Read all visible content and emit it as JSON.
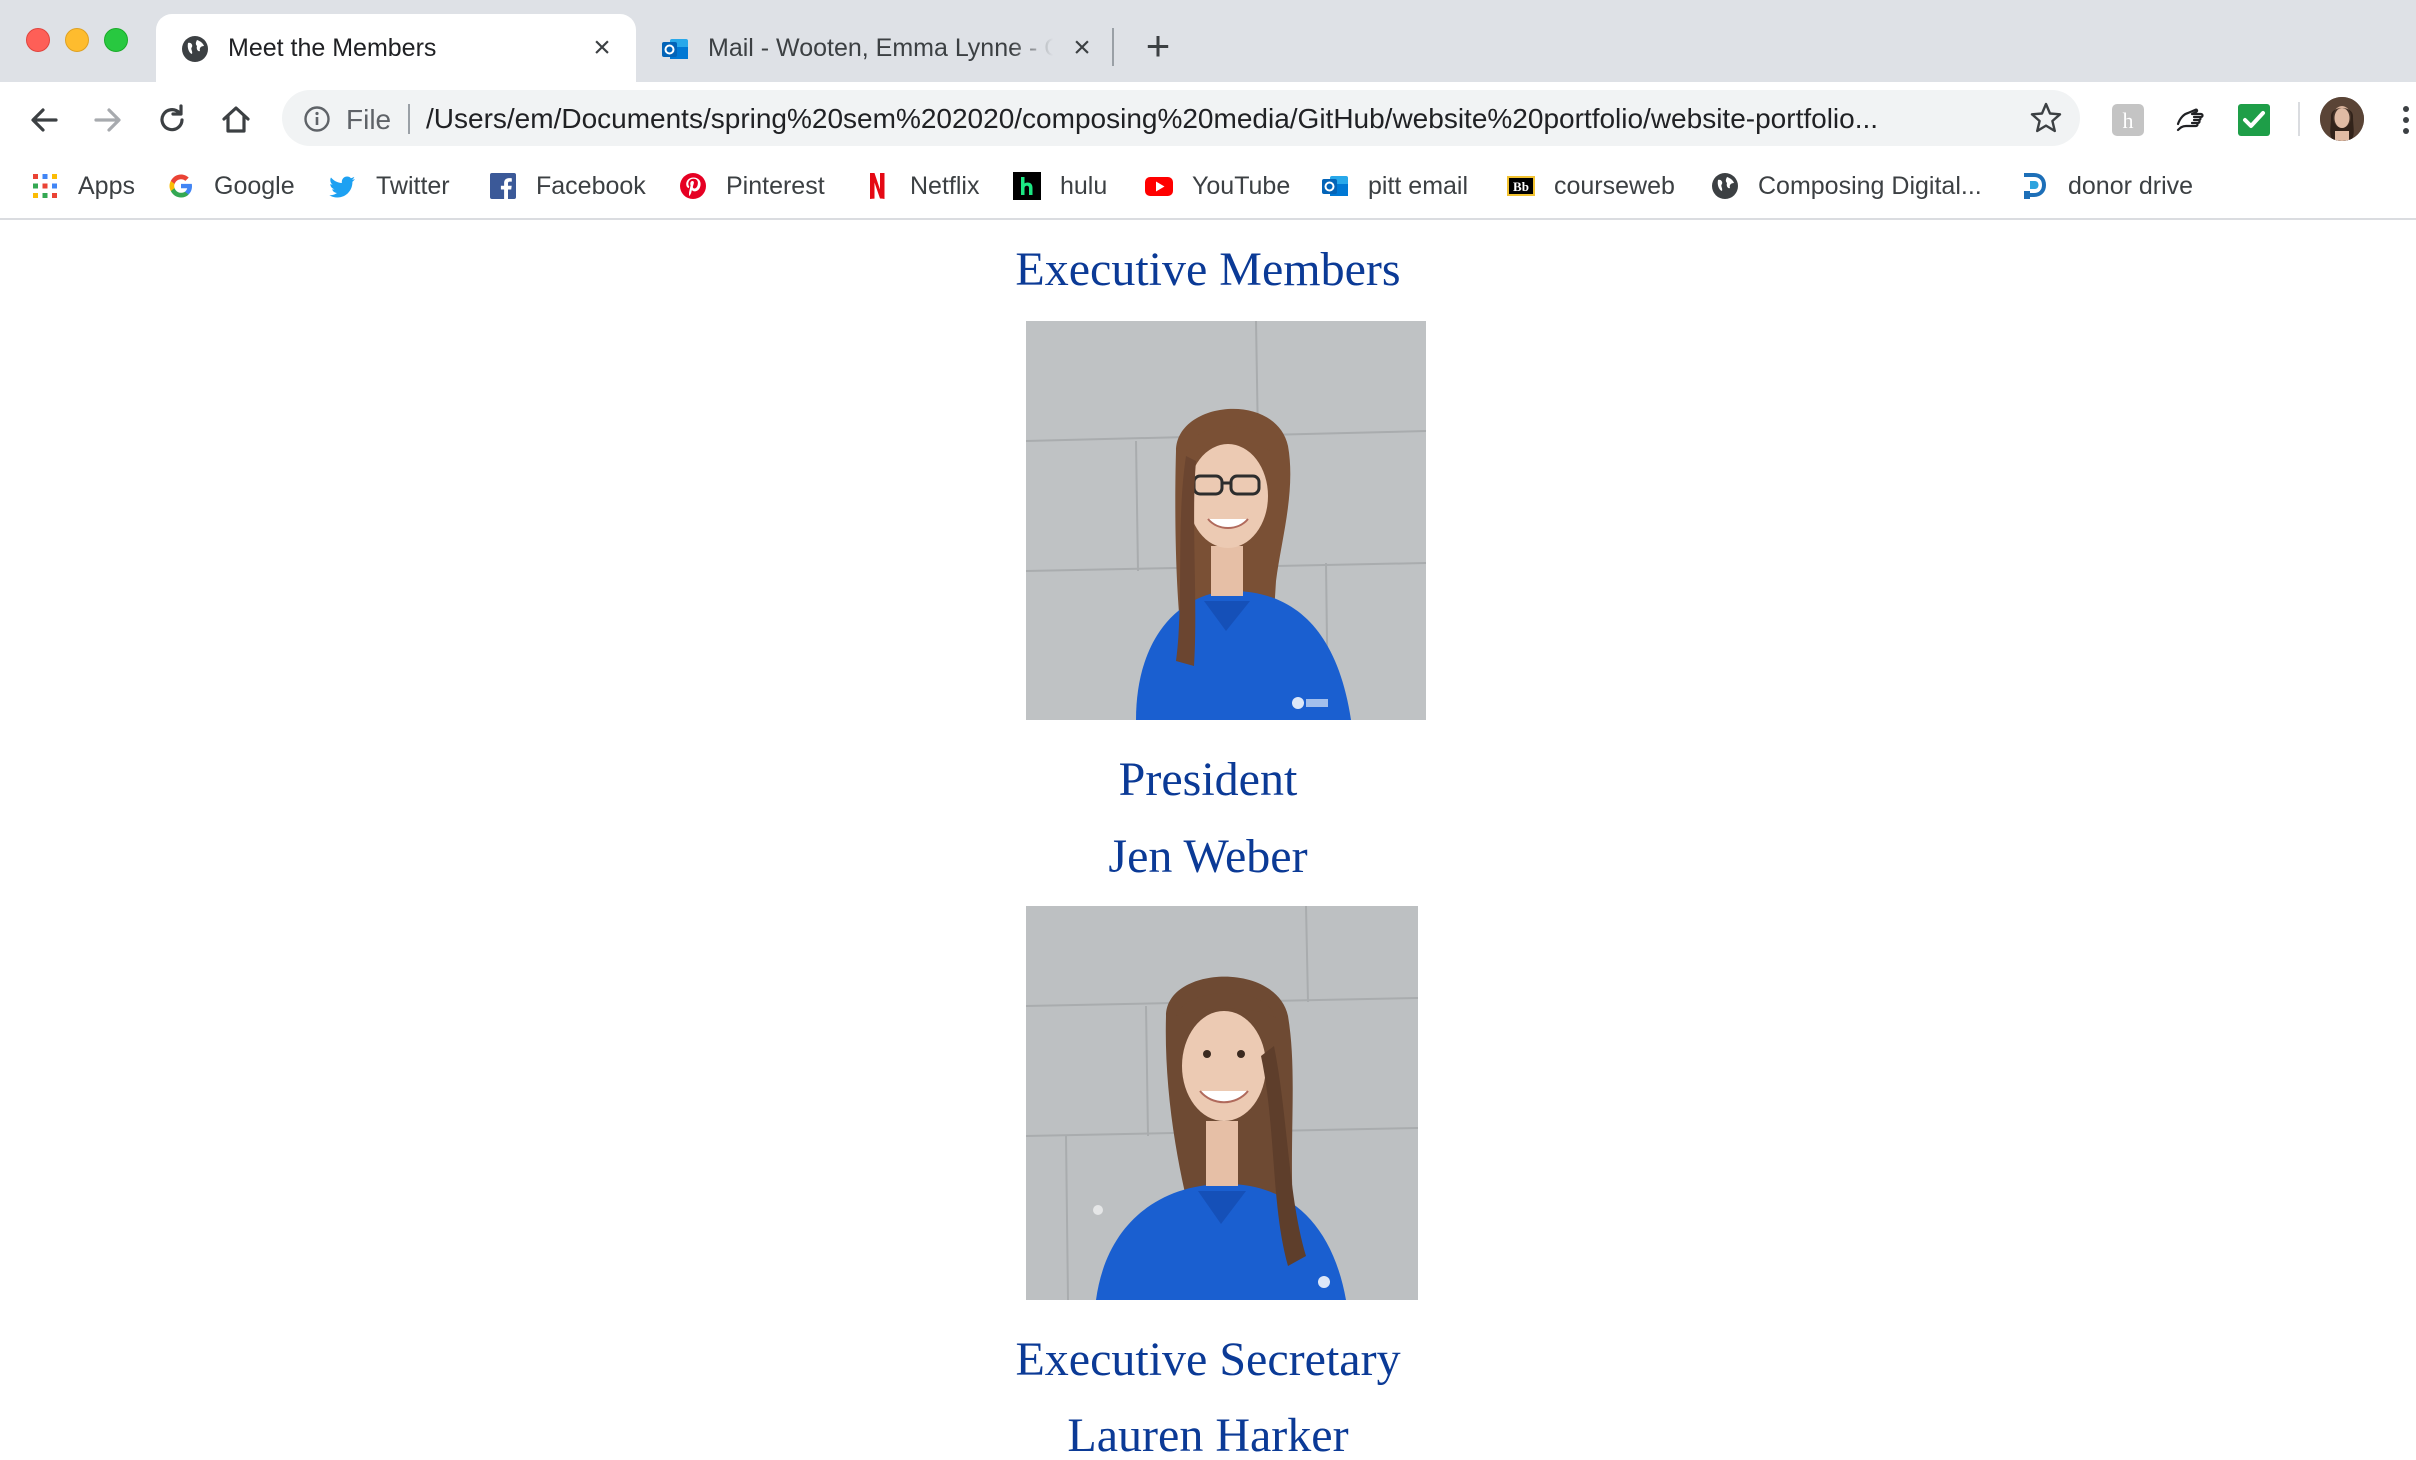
{
  "browser": {
    "tabs": [
      {
        "title": "Meet the Members",
        "active": true,
        "icon": "globe-icon"
      },
      {
        "title": "Mail - Wooten, Emma Lynne - Outlook",
        "active": false,
        "icon": "outlook-icon"
      }
    ],
    "omnibox": {
      "scheme_label": "File",
      "url": "/Users/em/Documents/spring%20sem%202020/composing%20media/GitHub/website%20portfolio/website-portfolio..."
    },
    "bookmarks": [
      {
        "label": "Apps",
        "icon": "apps-grid-icon"
      },
      {
        "label": "Google",
        "icon": "google-icon"
      },
      {
        "label": "Twitter",
        "icon": "twitter-icon"
      },
      {
        "label": "Facebook",
        "icon": "facebook-icon"
      },
      {
        "label": "Pinterest",
        "icon": "pinterest-icon"
      },
      {
        "label": "Netflix",
        "icon": "netflix-icon"
      },
      {
        "label": "hulu",
        "icon": "hulu-icon"
      },
      {
        "label": "YouTube",
        "icon": "youtube-icon"
      },
      {
        "label": "pitt email",
        "icon": "outlook-icon"
      },
      {
        "label": "courseweb",
        "icon": "blackboard-icon"
      },
      {
        "label": "Composing Digital...",
        "icon": "globe-icon"
      },
      {
        "label": "donor drive",
        "icon": "donor-drive-icon"
      }
    ]
  },
  "page": {
    "section_title": "Executive Members",
    "members": [
      {
        "role": "President",
        "name": "Jen Weber"
      },
      {
        "role": "Executive Secretary",
        "name": "Lauren Harker"
      }
    ]
  },
  "colors": {
    "heading_text": "#0b3a96",
    "tabstrip_bg": "#dee1e6",
    "shirt_blue": "#1a5fd0"
  }
}
